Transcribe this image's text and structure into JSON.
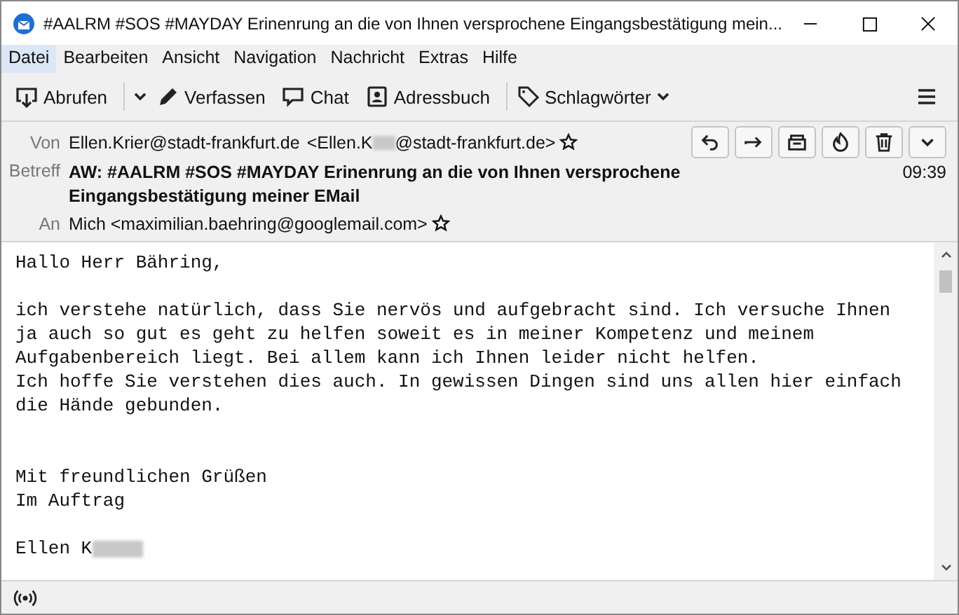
{
  "window": {
    "title": "#AALRM #SOS #MAYDAY Erinenrung an die von Ihnen versprochene Eingangsbestätigung mein..."
  },
  "menu": [
    {
      "label": "Datei",
      "selected": true
    },
    {
      "label": "Bearbeiten",
      "selected": false
    },
    {
      "label": "Ansicht",
      "selected": false
    },
    {
      "label": "Navigation",
      "selected": false
    },
    {
      "label": "Nachricht",
      "selected": false
    },
    {
      "label": "Extras",
      "selected": false
    },
    {
      "label": "Hilfe",
      "selected": false
    }
  ],
  "toolbar": [
    {
      "kind": "get",
      "label": "Abrufen"
    },
    {
      "kind": "dropdown"
    },
    {
      "kind": "compose",
      "label": "Verfassen"
    },
    {
      "kind": "chat",
      "label": "Chat"
    },
    {
      "kind": "addressbook",
      "label": "Adressbuch"
    },
    {
      "kind": "tags",
      "label": "Schlagwörter"
    }
  ],
  "header": {
    "from_label": "Von",
    "from_name": "Ellen.Krier@stadt-frankfurt.de",
    "from_address_start": "<Ellen.K",
    "from_address_end": "@stadt-frankfurt.de>",
    "subject_label": "Betreff",
    "subject": "AW: #AALRM #SOS #MAYDAY Erinenrung an die von Ihnen versprochene Eingangsbestätigung meiner EMail",
    "time": "09:39",
    "to_label": "An",
    "to": "Mich <maximilian.baehring@googlemail.com>",
    "actions": [
      {
        "kind": "reply"
      },
      {
        "kind": "forward"
      },
      {
        "kind": "archive"
      },
      {
        "kind": "junk"
      },
      {
        "kind": "delete"
      },
      {
        "kind": "more"
      }
    ]
  },
  "body": [
    {
      "kind": "greeting",
      "lines": [
        "Hallo Herr Bähring,"
      ]
    },
    {
      "kind": "text",
      "lines": [
        "ich verstehe natürlich, dass Sie nervös und aufgebracht sind. Ich versuche Ihnen",
        "ja auch so gut es geht zu helfen soweit es in meiner Kompetenz und meinem",
        "Aufgabenbereich liegt. Bei allem kann ich Ihnen leider nicht helfen.",
        "Ich hoffe Sie verstehen dies auch. In gewissen Dingen sind uns allen hier einfach",
        "die Hände gebunden."
      ]
    },
    {
      "kind": "closing",
      "lines": [
        "Mit freundlichen Grüßen",
        "Im Auftrag"
      ]
    },
    {
      "kind": "signature",
      "lines": [
        "Ellen K"
      ]
    }
  ]
}
